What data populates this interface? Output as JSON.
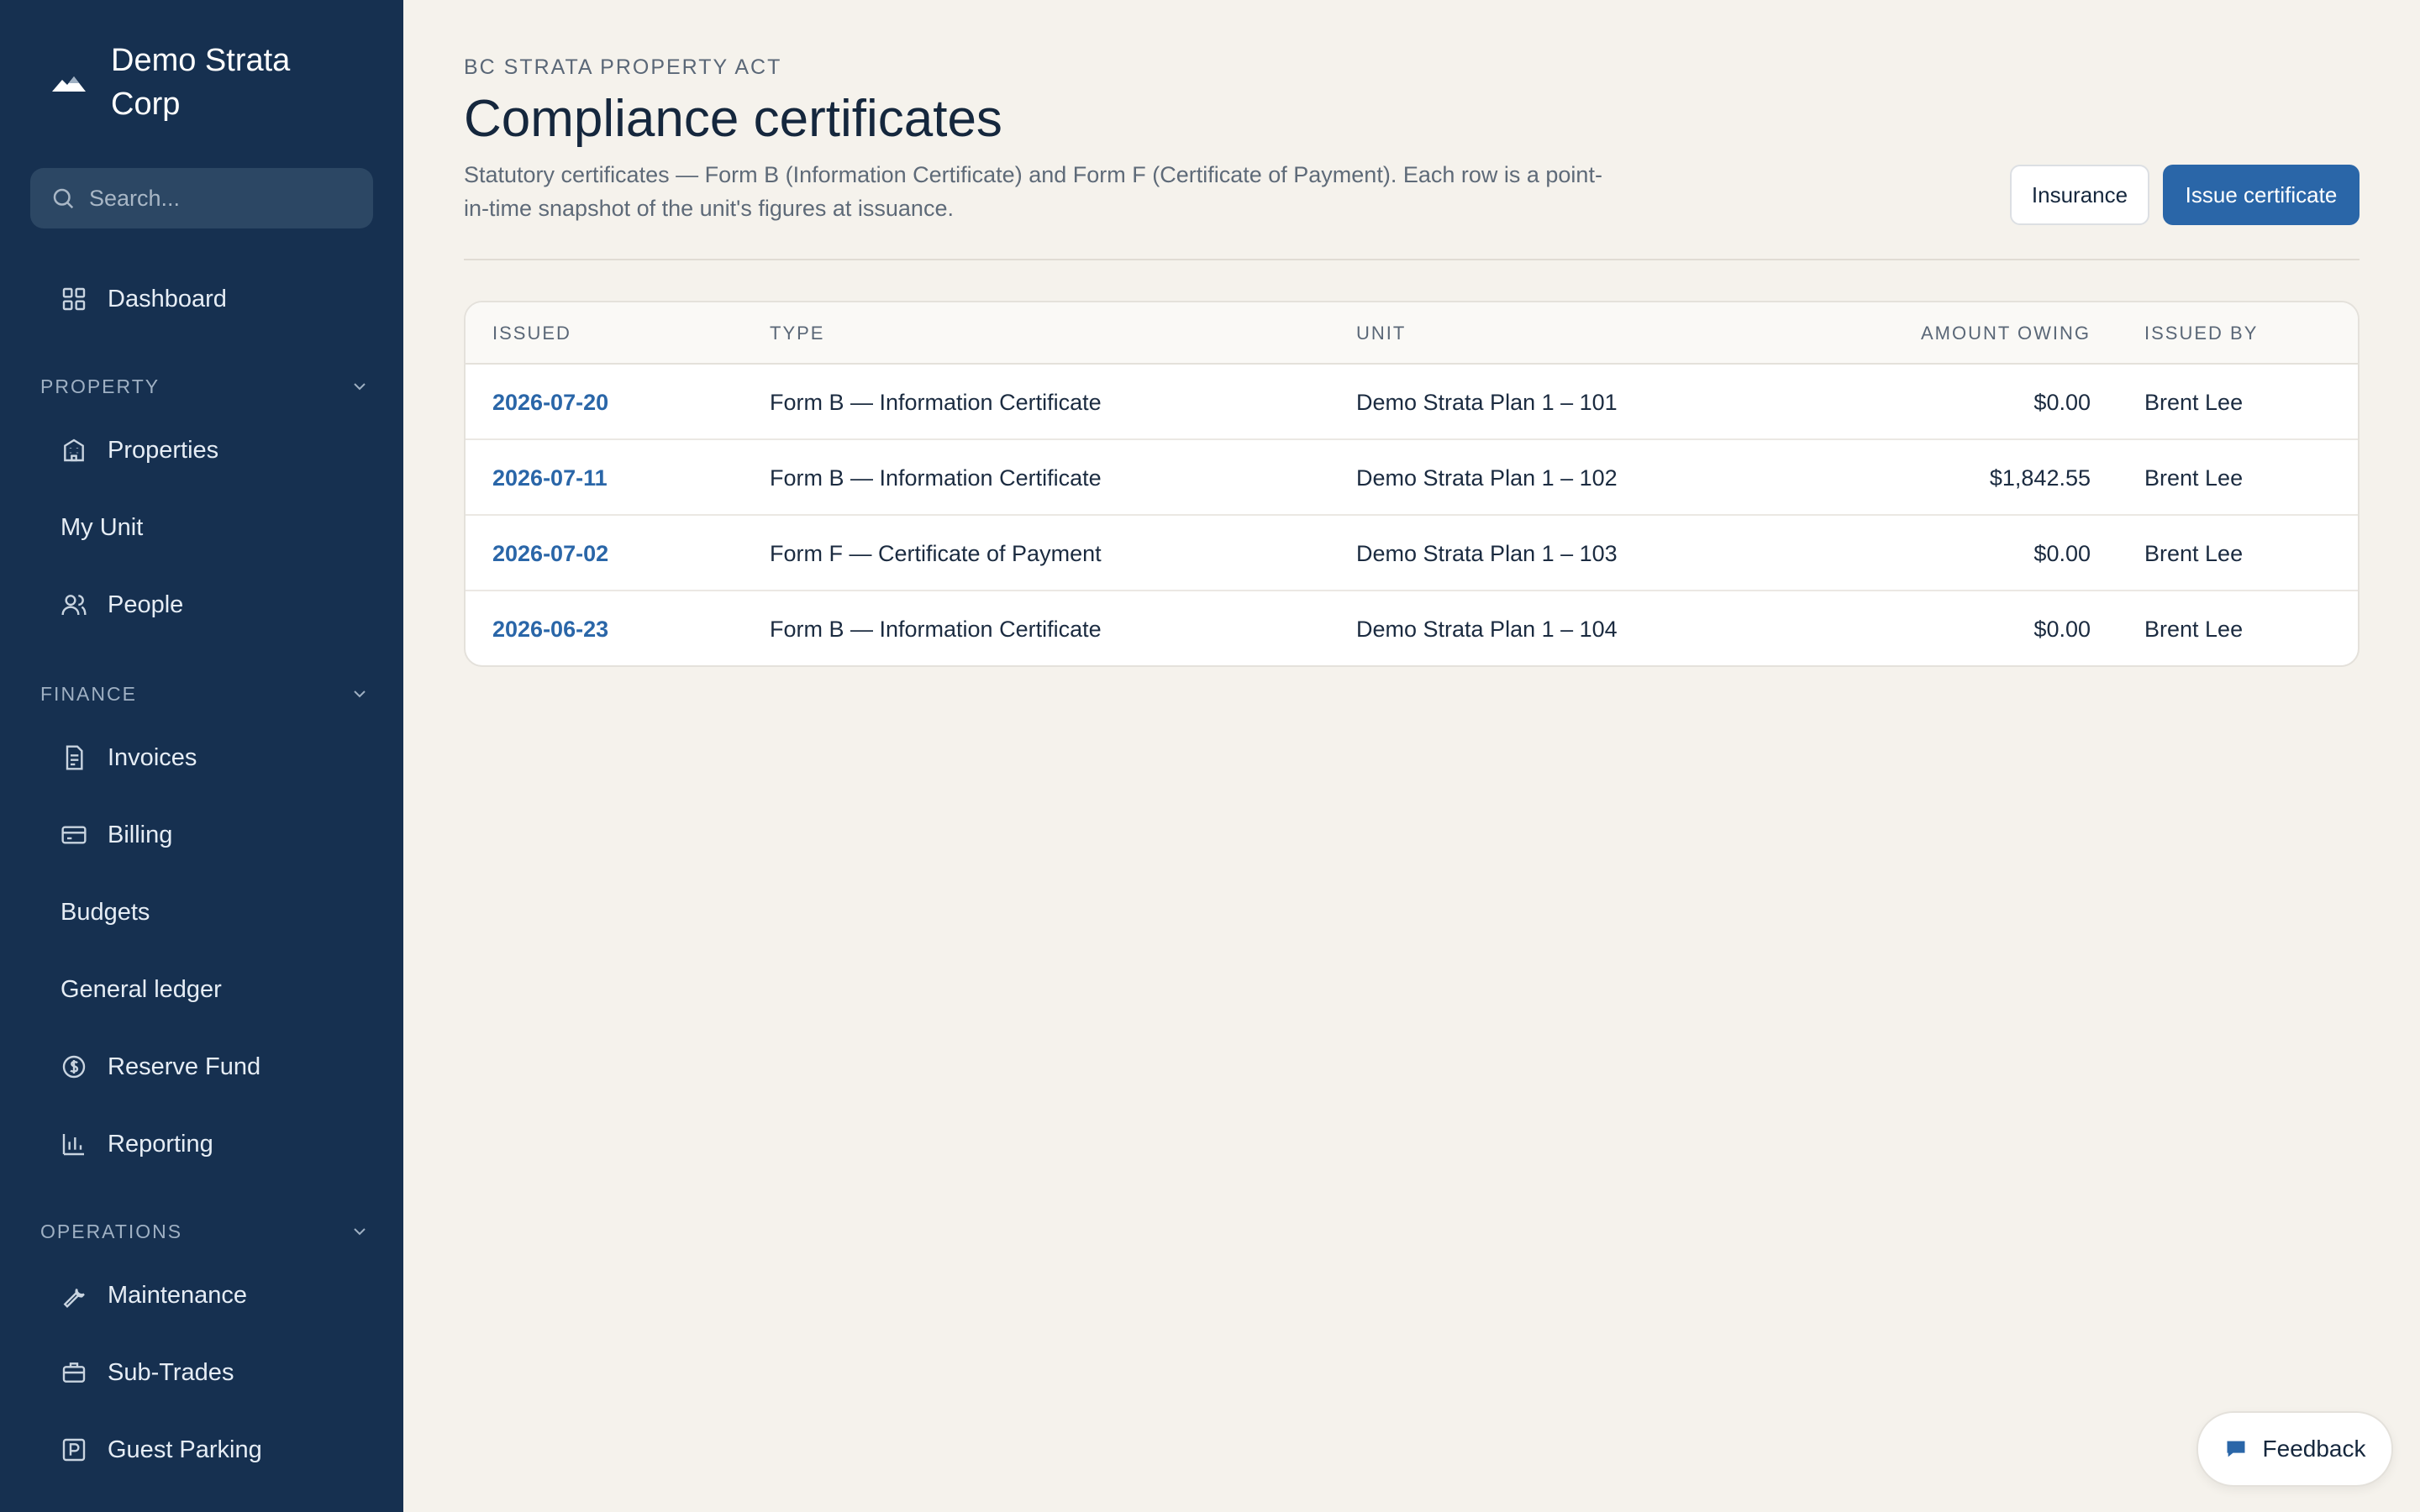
{
  "brand": {
    "name": "Demo Strata Corp"
  },
  "search": {
    "placeholder": "Search..."
  },
  "sidebar": {
    "dashboard": {
      "label": "Dashboard",
      "icon": "grid-icon"
    },
    "property_section": "PROPERTY",
    "properties": {
      "label": "Properties",
      "icon": "building-icon"
    },
    "my_unit": {
      "label": "My Unit"
    },
    "people": {
      "label": "People",
      "icon": "users-icon"
    },
    "finance_section": "FINANCE",
    "invoices": {
      "label": "Invoices",
      "icon": "document-icon"
    },
    "billing": {
      "label": "Billing",
      "icon": "credit-card-icon"
    },
    "budgets": {
      "label": "Budgets"
    },
    "general_ledger": {
      "label": "General ledger"
    },
    "reserve_fund": {
      "label": "Reserve Fund",
      "icon": "coin-icon"
    },
    "reporting": {
      "label": "Reporting",
      "icon": "bar-chart-icon"
    },
    "operations_section": "OPERATIONS",
    "maintenance": {
      "label": "Maintenance",
      "icon": "wrench-icon"
    },
    "sub_trades": {
      "label": "Sub-Trades",
      "icon": "briefcase-icon"
    },
    "guest_parking": {
      "label": "Guest Parking",
      "icon": "parking-icon"
    }
  },
  "header": {
    "eyebrow": "BC STRATA PROPERTY ACT",
    "title": "Compliance certificates",
    "description": "Statutory certificates — Form B (Information Certificate) and Form F (Certificate of Payment). Each row is a point-in-time snapshot of the unit's figures at issuance.",
    "insurance_button": "Insurance",
    "issue_button": "Issue certificate"
  },
  "table": {
    "columns": [
      "ISSUED",
      "TYPE",
      "UNIT",
      "AMOUNT OWING",
      "ISSUED BY"
    ],
    "rows": [
      [
        "2026-07-20",
        "Form B — Information Certificate",
        "Demo Strata Plan 1 – 101",
        "$0.00",
        "Brent Lee"
      ],
      [
        "2026-07-11",
        "Form B — Information Certificate",
        "Demo Strata Plan 1 – 102",
        "$1,842.55",
        "Brent Lee"
      ],
      [
        "2026-07-02",
        "Form F — Certificate of Payment",
        "Demo Strata Plan 1 – 103",
        "$0.00",
        "Brent Lee"
      ],
      [
        "2026-06-23",
        "Form B — Information Certificate",
        "Demo Strata Plan 1 – 104",
        "$0.00",
        "Brent Lee"
      ]
    ]
  },
  "feedback": {
    "label": "Feedback"
  },
  "colors": {
    "sidebar_bg": "#163050",
    "page_bg": "#f5f2ec",
    "accent": "#2a66a8",
    "heading": "#15273d"
  }
}
